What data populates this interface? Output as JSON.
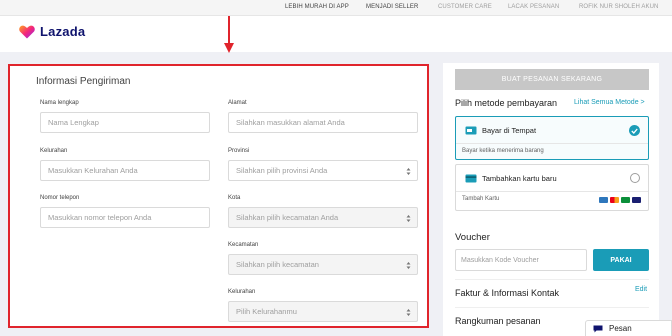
{
  "topbar": {
    "links": [
      {
        "label": "LEBIH MURAH DI APP",
        "style": "normal"
      },
      {
        "label": "MENJADI SELLER",
        "style": "normal"
      },
      {
        "label": "CUSTOMER CARE",
        "style": "faded"
      },
      {
        "label": "LACAK PESANAN",
        "style": "faded"
      },
      {
        "label": "ROFIK NUR SHOLEH AKUN",
        "style": "faded"
      }
    ]
  },
  "header": {
    "brand": "Lazada",
    "brand_icon": "lazada-heart-icon"
  },
  "annotation": {
    "icon": "red-down-arrow-icon",
    "color": "#e0242c"
  },
  "shipping": {
    "title": "Informasi Pengiriman",
    "fields": {
      "full_name": {
        "label": "Nama lengkap",
        "placeholder": "Nama Lengkap"
      },
      "address": {
        "label": "Alamat",
        "placeholder": "Silahkan masukkan alamat Anda"
      },
      "village": {
        "label": "Kelurahan",
        "placeholder": "Masukkan Kelurahan Anda"
      },
      "province": {
        "label": "Provinsi",
        "placeholder": "Silahkan pilih provinsi Anda"
      },
      "phone": {
        "label": "Nomor telepon",
        "placeholder": "Masukkan nomor telepon Anda"
      },
      "city": {
        "label": "Kota",
        "placeholder": "Silahkan pilih kecamatan Anda"
      },
      "district": {
        "label": "Kecamatan",
        "placeholder": "Silahkan pilih kecamatan"
      },
      "village_select": {
        "label": "Kelurahan",
        "placeholder": "Pilih Kelurahanmu"
      }
    }
  },
  "checkout": {
    "order_button": "BUAT PESANAN SEKARANG",
    "payment_title": "Pilih metode pembayaran",
    "payment_link": "Lihat Semua Metode >",
    "payment_options": [
      {
        "name": "Bayar di Tempat",
        "sub": "Bayar ketika menerima barang",
        "selected": true,
        "icon": "cash-card-icon"
      },
      {
        "name": "Tambahkan kartu baru",
        "sub": "Tambah Kartu",
        "selected": false,
        "icon": "credit-card-icon"
      }
    ],
    "card_brand_icons": [
      "amex-icon",
      "mastercard-icon",
      "jcb-icon",
      "visa-icon"
    ],
    "voucher_title": "Voucher",
    "voucher_placeholder": "Masukkan Kode Voucher",
    "voucher_button": "PAKAI",
    "invoice_title": "Faktur & Informasi Kontak",
    "invoice_edit": "Edit",
    "summary_title": "Rangkuman pesanan"
  },
  "chat": {
    "label": "Pesan",
    "icon": "chat-bubble-icon"
  },
  "colors": {
    "accent": "#1a9cb7",
    "brand": "#0f136d",
    "highlight": "#e0242c",
    "disabled": "#c7c7c7"
  }
}
